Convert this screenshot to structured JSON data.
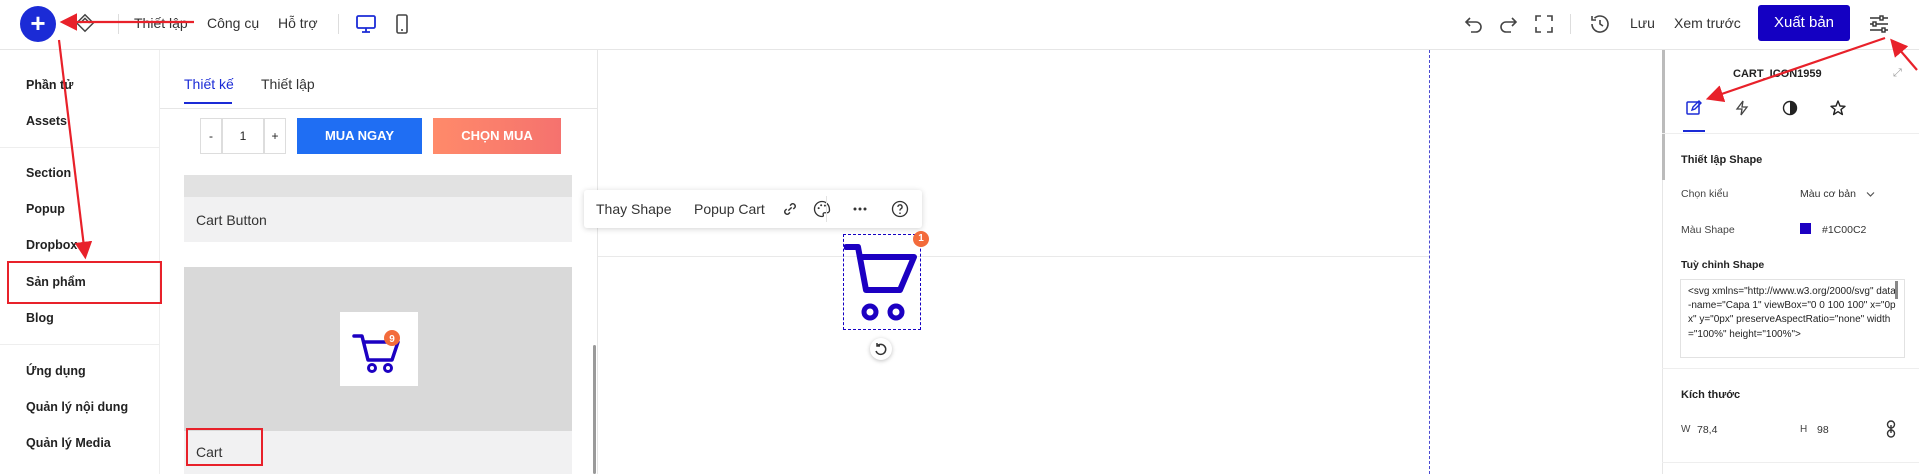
{
  "topbar": {
    "menu": [
      "Thiết lập",
      "Công cụ",
      "Hỗ trợ"
    ],
    "save_label": "Lưu",
    "preview_label": "Xem trước",
    "publish_label": "Xuất bản"
  },
  "leftnav": {
    "items": [
      "Phần tử",
      "Assets",
      "Section",
      "Popup",
      "Dropbox",
      "Sản phẩm",
      "Blog",
      "Ứng dụng",
      "Quản lý nội dung",
      "Quản lý Media"
    ]
  },
  "panel": {
    "tabs": [
      "Thiết kế",
      "Thiết lập"
    ],
    "qty_minus": "-",
    "qty_value": "1",
    "qty_plus": "+",
    "buy_now": "MUA NGAY",
    "choose_buy": "CHỌN MUA",
    "card1_label": "Cart Button",
    "card2_label": "Cart",
    "thumb_badge": "9"
  },
  "toolbar": {
    "change_shape": "Thay Shape",
    "popup_cart": "Popup Cart"
  },
  "canvas": {
    "badge": "1"
  },
  "rpanel": {
    "title": "CART_ICON1959",
    "section_shape": "Thiết lập Shape",
    "choose_style_label": "Chọn kiểu",
    "choose_style_value": "Màu cơ bản",
    "shape_color_label": "Màu Shape",
    "shape_color_value": "#1C00C2",
    "custom_shape_label": "Tuỳ chỉnh Shape",
    "custom_shape_code": "<svg xmlns=\"http://www.w3.org/2000/svg\" data-name=\"Capa 1\" viewBox=\"0 0 100 100\" x=\"0px\" y=\"0px\" preserveAspectRatio=\"none\" width=\"100%\" height=\"100%\">",
    "size_section": "Kích thước",
    "w_label": "W",
    "w_value": "78,4",
    "h_label": "H",
    "h_value": "98"
  },
  "colors": {
    "accent": "#1b2bd6",
    "publish": "#1400c2",
    "shape": "#1C00C2",
    "buy_now": "#1f6ef3",
    "choose_buy": "#f5726e",
    "badge": "#f36b3b",
    "annotation": "#e8212a"
  }
}
